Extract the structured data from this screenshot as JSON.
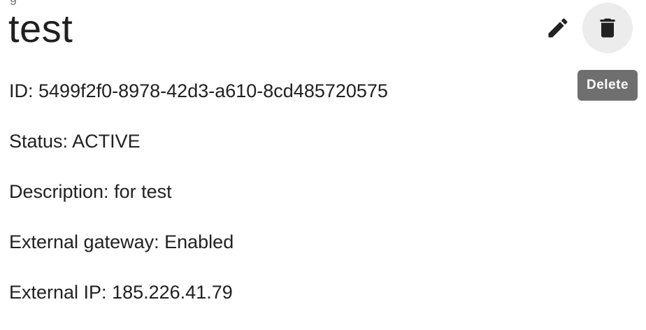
{
  "header": {
    "cut_text": "g",
    "title": "test"
  },
  "actions": {
    "edit_icon": "pencil-icon",
    "delete_icon": "trash-icon",
    "tooltip": "Delete"
  },
  "details": [
    {
      "label": "ID: ",
      "value": "5499f2f0-8978-42d3-a610-8cd485720575"
    },
    {
      "label": "Status: ",
      "value": "ACTIVE"
    },
    {
      "label": "Description: ",
      "value": "for test"
    },
    {
      "label": "External gateway: ",
      "value": "Enabled"
    },
    {
      "label": "External IP: ",
      "value": "185.226.41.79"
    }
  ]
}
